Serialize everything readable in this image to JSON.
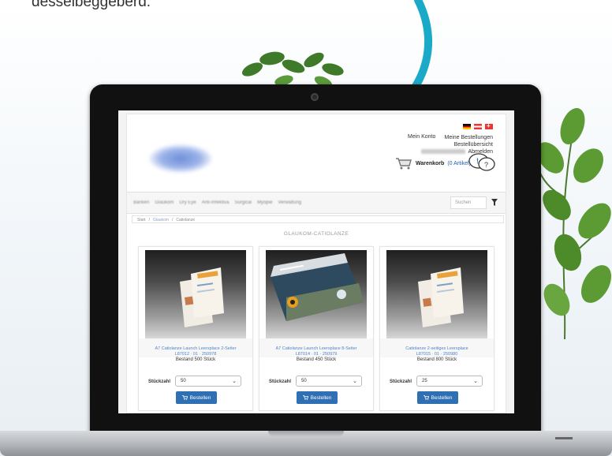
{
  "header": {
    "account_link": "Mein Konto",
    "orders_link": "Meine Bestellungen",
    "orders_overview": "Bestellübersicht",
    "logout": "Abmelden",
    "cart_label": "Warenkorb",
    "cart_count": "(0 Artikel)"
  },
  "nav": {
    "items": [
      "Banken",
      "Glaukom",
      "Dry Eye",
      "Anti-Infektiva",
      "Surgical",
      "Myopie",
      "Verwaltung"
    ],
    "search_placeholder": "Suchen"
  },
  "breadcrumb": {
    "home": "Start",
    "level1": "Glaukom",
    "level2": "Catiolanze"
  },
  "page": {
    "title": "GLAUKOM-CATIOLANZE"
  },
  "products": [
    {
      "name": "A7 Catiolanze Launch Leersplace 2-Seiter",
      "sku": "L87012 · 01 · 250978",
      "stock": "Bestand 500 Stück",
      "qty_label": "Stückzahl",
      "qty_value": "50",
      "order_label": "Bestellen"
    },
    {
      "name": "A7 Catiolanze Launch Leersplace 8-Seiter",
      "sku": "L87014 · 01 · 250979",
      "stock": "Bestand 450 Stück",
      "qty_label": "Stückzahl",
      "qty_value": "50",
      "order_label": "Bestellen"
    },
    {
      "name": "Catiolanze 2-seitiges Leersplace",
      "sku": "L87015 · 01 · 250980",
      "stock": "Bestand 800 Stück",
      "qty_label": "Stückzahl",
      "qty_value": "25",
      "order_label": "Bestellen"
    }
  ],
  "colors": {
    "accent_arrow": "#1aaac8",
    "button": "#2f6fb3",
    "link": "#4f83c8"
  }
}
